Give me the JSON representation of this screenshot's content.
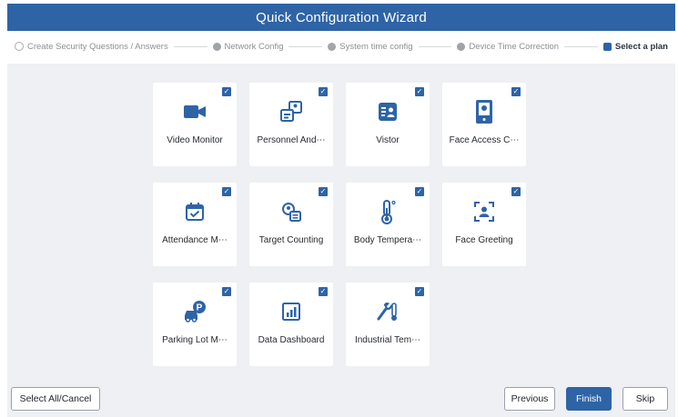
{
  "window": {
    "title": "Quick Configuration Wizard"
  },
  "steps": [
    {
      "label": "Create Security Questions / Answers",
      "icon": "shield-outline-icon",
      "active": false
    },
    {
      "label": "Network Config",
      "icon": "gear-icon",
      "active": false
    },
    {
      "label": "System time config",
      "icon": "clock-icon",
      "active": false
    },
    {
      "label": "Device Time Correction",
      "icon": "gear-icon",
      "active": false
    },
    {
      "label": "Select a plan",
      "icon": "plan-icon",
      "active": true
    }
  ],
  "tiles": [
    {
      "label": "Video Monitor",
      "icon": "video-camera-icon",
      "checked": true
    },
    {
      "label": "Personnel And⋯",
      "icon": "personnel-icon",
      "checked": true
    },
    {
      "label": "Vistor",
      "icon": "visitor-card-icon",
      "checked": true
    },
    {
      "label": "Face Access C⋯",
      "icon": "face-access-icon",
      "checked": true
    },
    {
      "label": "Attendance M⋯",
      "icon": "calendar-check-icon",
      "checked": true
    },
    {
      "label": "Target Counting",
      "icon": "target-counting-icon",
      "checked": true
    },
    {
      "label": "Body Tempera⋯",
      "icon": "thermometer-icon",
      "checked": true
    },
    {
      "label": "Face Greeting",
      "icon": "face-scan-icon",
      "checked": true
    },
    {
      "label": "Parking Lot M⋯",
      "icon": "parking-icon",
      "checked": true
    },
    {
      "label": "Data Dashboard",
      "icon": "chart-dashboard-icon",
      "checked": true
    },
    {
      "label": "Industrial Tem⋯",
      "icon": "industrial-temp-icon",
      "checked": true
    }
  ],
  "buttons": {
    "select_all": "Select All/Cancel",
    "previous": "Previous",
    "finish": "Finish",
    "skip": "Skip"
  },
  "colors": {
    "accent": "#2e64a6",
    "background": "#eef0f3",
    "title_bar": "#2e64a6"
  }
}
